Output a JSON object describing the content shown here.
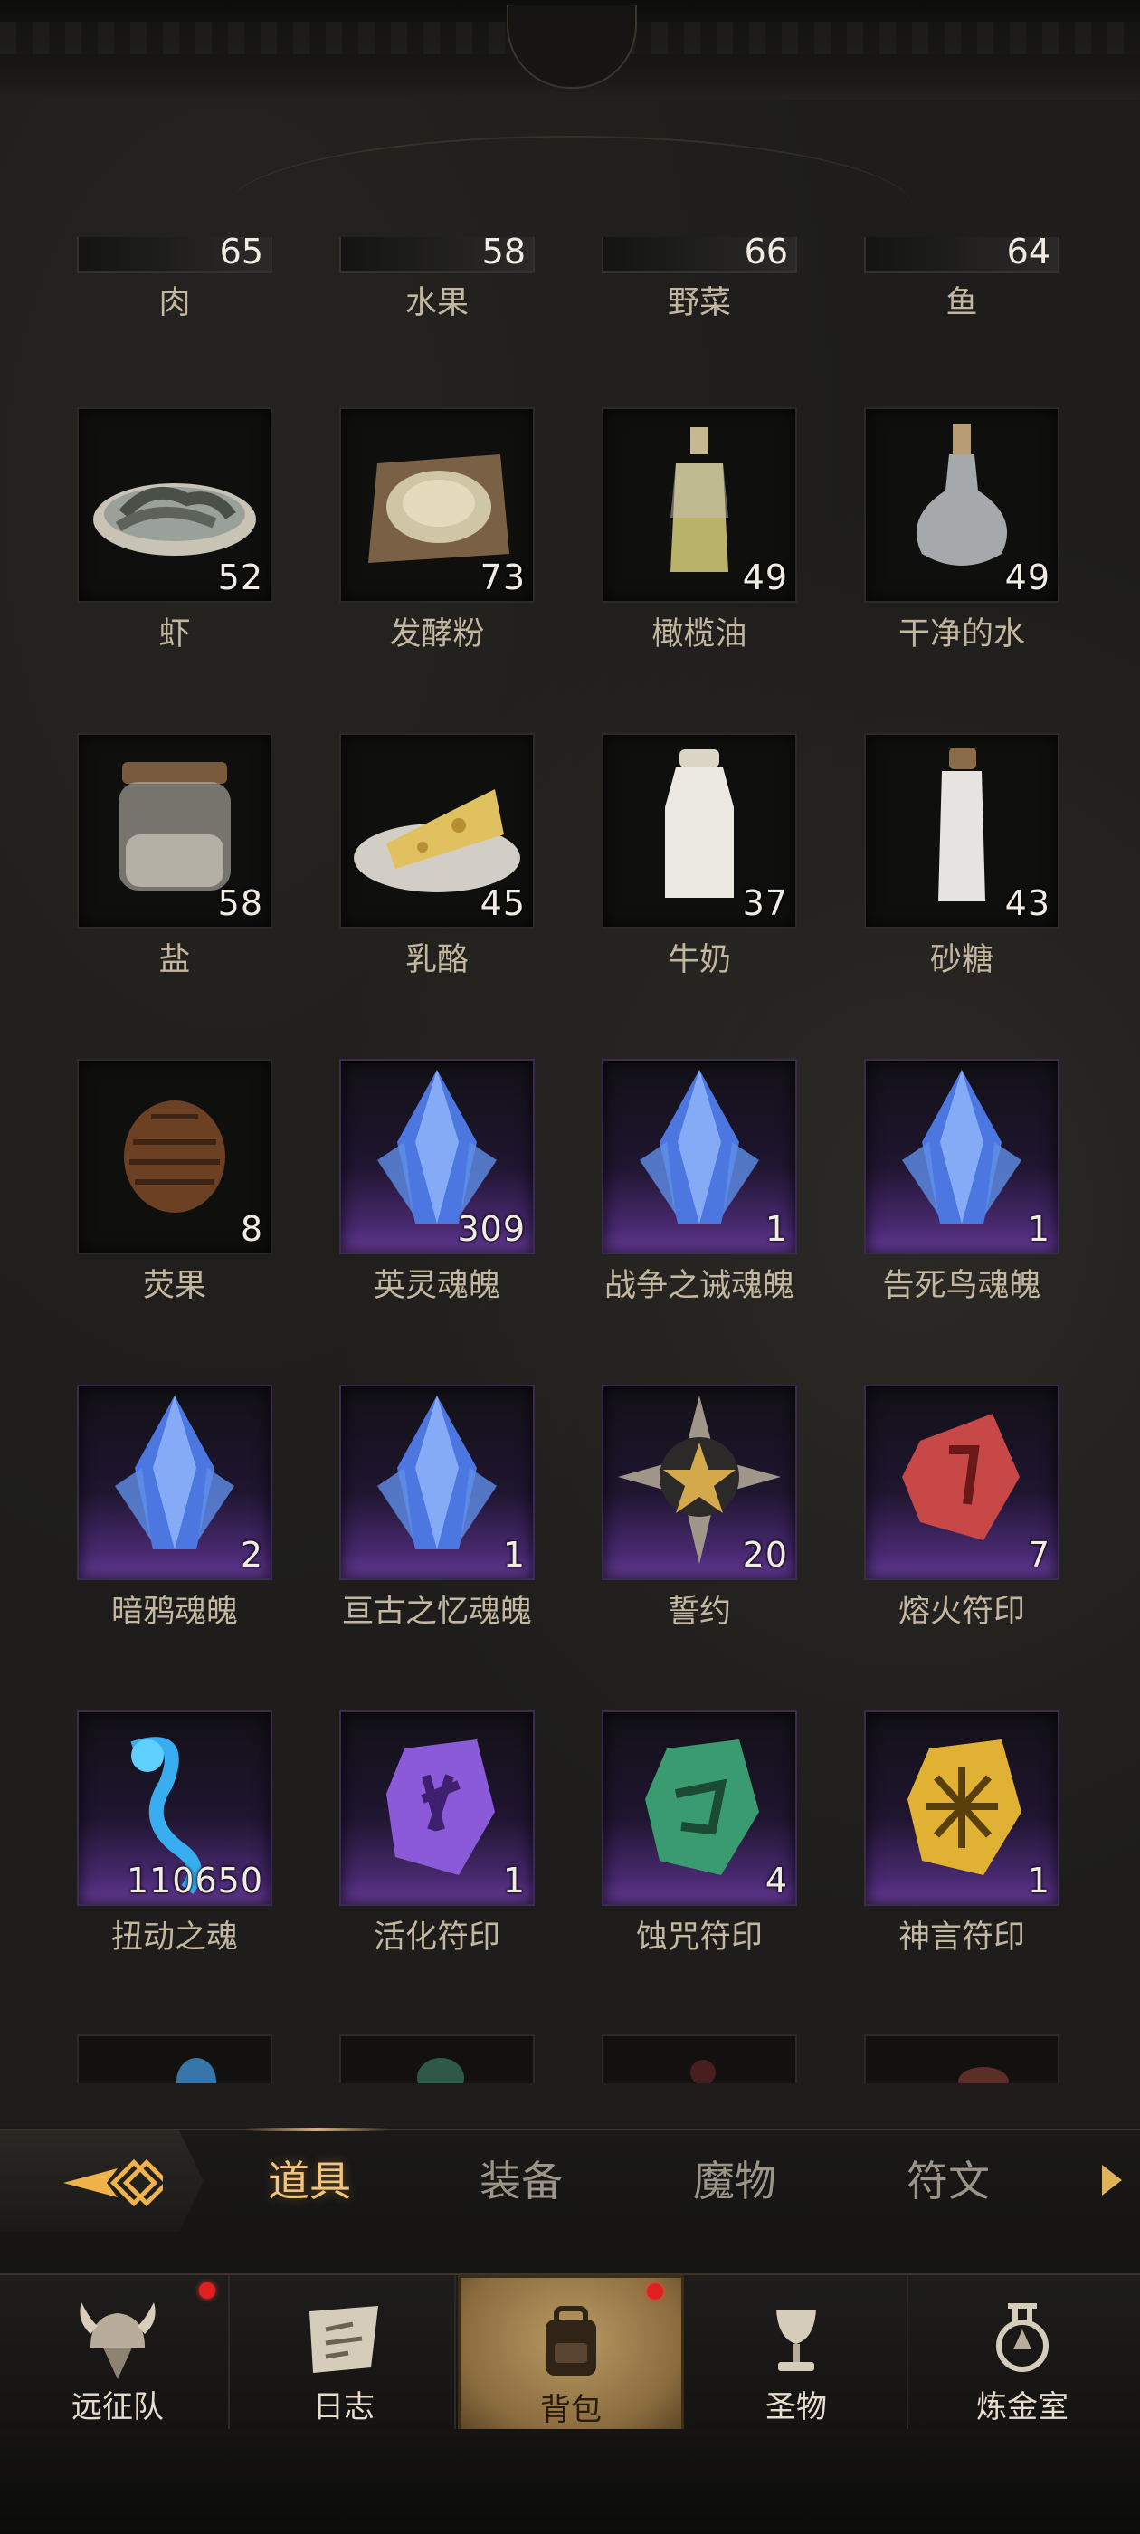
{
  "top_row": [
    {
      "name": "肉",
      "count": "65"
    },
    {
      "name": "水果",
      "count": "58"
    },
    {
      "name": "野菜",
      "count": "66"
    },
    {
      "name": "鱼",
      "count": "64"
    }
  ],
  "items": [
    {
      "name": "虾",
      "count": "52",
      "rarity": "normal",
      "icon": "shrimp-icon"
    },
    {
      "name": "发酵粉",
      "count": "73",
      "rarity": "normal",
      "icon": "yeast-powder-icon"
    },
    {
      "name": "橄榄油",
      "count": "49",
      "rarity": "normal",
      "icon": "olive-oil-icon"
    },
    {
      "name": "干净的水",
      "count": "49",
      "rarity": "normal",
      "icon": "clean-water-icon"
    },
    {
      "name": "盐",
      "count": "58",
      "rarity": "normal",
      "icon": "salt-jar-icon"
    },
    {
      "name": "乳酪",
      "count": "45",
      "rarity": "normal",
      "icon": "cheese-icon"
    },
    {
      "name": "牛奶",
      "count": "37",
      "rarity": "normal",
      "icon": "milk-bottle-icon"
    },
    {
      "name": "砂糖",
      "count": "43",
      "rarity": "normal",
      "icon": "sugar-bottle-icon"
    },
    {
      "name": "荧果",
      "count": "8",
      "rarity": "normal",
      "icon": "pinecone-fruit-icon"
    },
    {
      "name": "英灵魂魄",
      "count": "309",
      "rarity": "epic",
      "icon": "soul-crystal-icon"
    },
    {
      "name": "战争之诫魂魄",
      "count": "1",
      "rarity": "epic",
      "icon": "soul-crystal-icon"
    },
    {
      "name": "告死鸟魂魄",
      "count": "1",
      "rarity": "epic",
      "icon": "soul-crystal-icon"
    },
    {
      "name": "暗鸦魂魄",
      "count": "2",
      "rarity": "epic",
      "icon": "soul-crystal-icon"
    },
    {
      "name": "亘古之忆魂魄",
      "count": "1",
      "rarity": "epic",
      "icon": "soul-crystal-icon"
    },
    {
      "name": "誓约",
      "count": "20",
      "rarity": "epic",
      "icon": "oath-medal-icon"
    },
    {
      "name": "熔火符印",
      "count": "7",
      "rarity": "epic",
      "icon": "red-rune-icon"
    },
    {
      "name": "扭动之魂",
      "count": "110650",
      "rarity": "epic",
      "icon": "blue-wisp-icon"
    },
    {
      "name": "活化符印",
      "count": "1",
      "rarity": "epic",
      "icon": "purple-rune-icon"
    },
    {
      "name": "蚀咒符印",
      "count": "4",
      "rarity": "epic",
      "icon": "green-rune-icon"
    },
    {
      "name": "神言符印",
      "count": "1",
      "rarity": "epic",
      "icon": "gold-rune-icon"
    }
  ],
  "tabs": [
    {
      "label": "道具",
      "active": true
    },
    {
      "label": "装备",
      "active": false
    },
    {
      "label": "魔物",
      "active": false
    },
    {
      "label": "符文",
      "active": false
    }
  ],
  "nav": [
    {
      "label": "远征队",
      "icon": "viking-helmet-icon",
      "badge": true,
      "active": false
    },
    {
      "label": "日志",
      "icon": "scroll-map-icon",
      "badge": false,
      "active": false
    },
    {
      "label": "背包",
      "icon": "backpack-icon",
      "badge": true,
      "active": true
    },
    {
      "label": "圣物",
      "icon": "chalice-icon",
      "badge": false,
      "active": false
    },
    {
      "label": "炼金室",
      "icon": "alchemy-icon",
      "badge": false,
      "active": false
    }
  ],
  "colors": {
    "accent": "#f0c47e",
    "epic_purple": "#6c3fa0",
    "badge_red": "#e02020"
  }
}
